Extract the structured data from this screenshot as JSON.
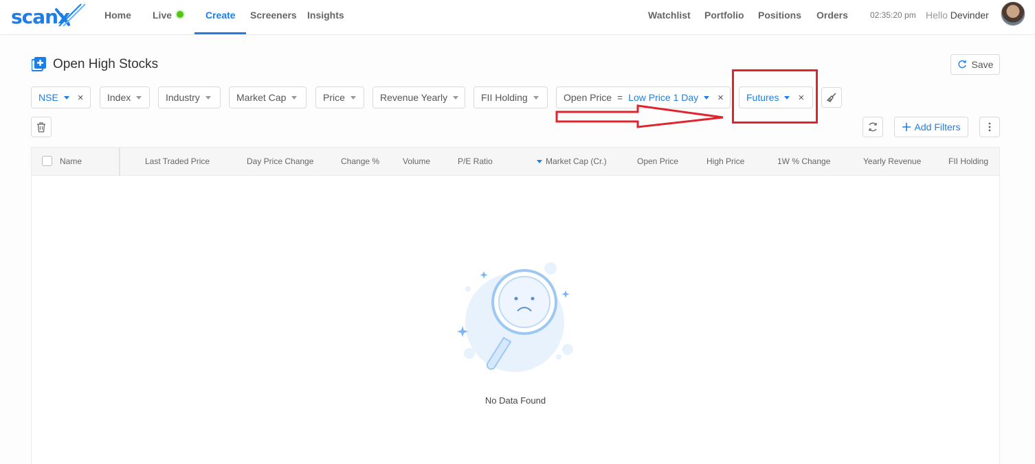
{
  "brand": {
    "logo_text": "scanx"
  },
  "nav": {
    "home": "Home",
    "live": "Live",
    "create": "Create",
    "screeners": "Screeners",
    "insights": "Insights",
    "watchlist": "Watchlist",
    "portfolio": "Portfolio",
    "positions": "Positions",
    "orders": "Orders",
    "clock": "02:35:20 pm",
    "hello": "Hello",
    "user": "Devinder"
  },
  "page": {
    "title": "Open High Stocks",
    "save_label": "Save"
  },
  "filters": {
    "exchange": "NSE",
    "index": "Index",
    "industry": "Industry",
    "market_cap": "Market Cap",
    "price": "Price",
    "revenue_yearly": "Revenue Yearly",
    "fii_holding": "FII Holding",
    "open_price_label": "Open Price",
    "open_price_op": "=",
    "open_price_value": "Low Price 1 Day",
    "futures": "Futures",
    "close_glyph": "×",
    "add_filters": "Add Filters"
  },
  "table": {
    "columns": [
      "Name",
      "Last Traded Price",
      "Day Price Change",
      "Change %",
      "Volume",
      "P/E Ratio",
      "Market Cap (Cr.)",
      "Open Price",
      "High Price",
      "1W % Change",
      "Yearly Revenue",
      "FII Holding"
    ],
    "sorted_column": "Market Cap (Cr.)",
    "empty_message": "No Data Found"
  },
  "colors": {
    "accent": "#1c7ee8",
    "live": "#52c41a",
    "annotation": "#e0242d"
  }
}
